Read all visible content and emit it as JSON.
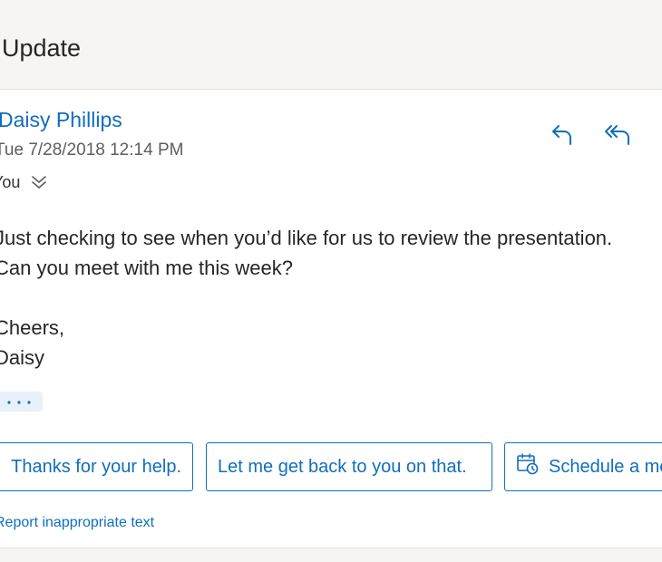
{
  "header": {
    "subject": "Update"
  },
  "message": {
    "sender": "Daisy Phillips",
    "date": "Tue 7/28/2018 12:14 PM",
    "recipients": "You",
    "body_lines": [
      "Just checking to see when you’d like for us to review the presentation.",
      "Can you meet with me this week?",
      "",
      "Cheers,",
      "Daisy"
    ]
  },
  "icons": {
    "reply": "reply-arrow-icon",
    "reply_all": "reply-all-arrow-icon",
    "expand": "double-chevron-down-icon",
    "more": "ellipsis-icon",
    "calendar": "calendar-clock-icon"
  },
  "suggested_replies": [
    "Thanks for your help.",
    "Let me get back to you on that.",
    "Schedule a meeting"
  ],
  "footer": {
    "report_link": "Report inappropriate text"
  },
  "colors": {
    "accent": "#106ebe",
    "header_bg": "#f6f5f4",
    "text": "#262626",
    "muted": "#605e5c"
  }
}
